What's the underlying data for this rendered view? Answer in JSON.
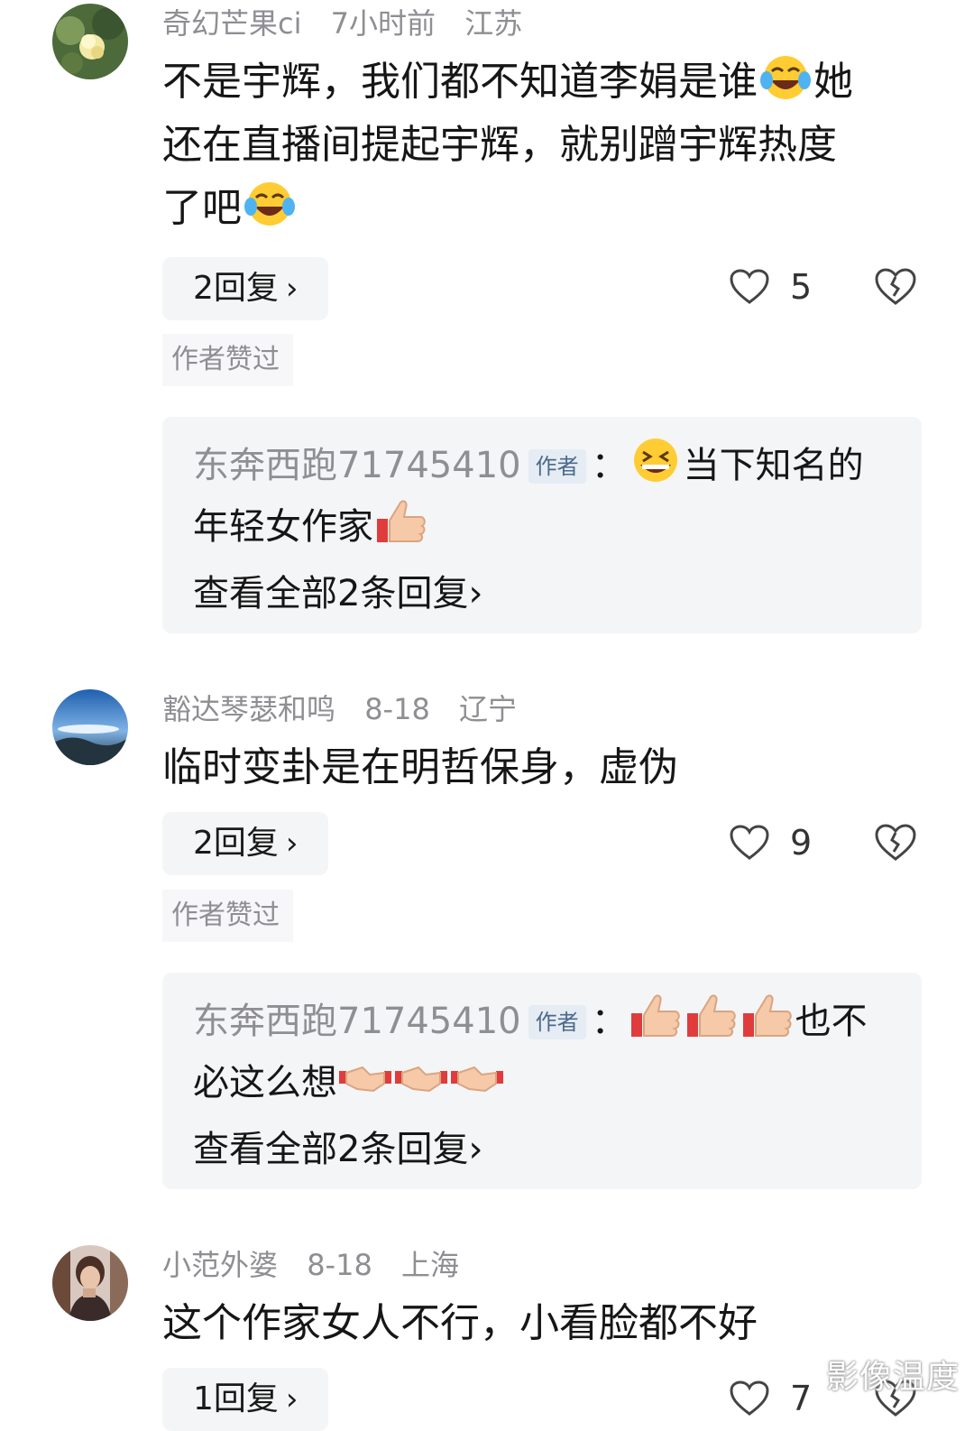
{
  "comments": [
    {
      "username": "奇幻芒果ci",
      "time": "7小时前",
      "location": "江苏",
      "text_line1": "不是宇辉，我们都不知道李娟是谁",
      "text_line1_after": "她",
      "text_line2": "还在直播间提起宇辉，就别蹭宇辉热度",
      "text_line3": "了吧",
      "reply_count_label": "2回复",
      "likes": "5",
      "author_liked": "作者赞过",
      "author_reply": {
        "user": "东奔西跑71745410",
        "badge": "作者",
        "colon": "：",
        "line1": "当下知名的",
        "line2": "年轻女作家",
        "view_all": "查看全部2条回复"
      }
    },
    {
      "username": "豁达琴瑟和鸣",
      "time": "8-18",
      "location": "辽宁",
      "text_line1": "临时变卦是在明哲保身，虚伪",
      "reply_count_label": "2回复",
      "likes": "9",
      "author_liked": "作者赞过",
      "author_reply": {
        "user": "东奔西跑71745410",
        "badge": "作者",
        "colon": "：",
        "line1": "也不",
        "line2": "必这么想",
        "view_all": "查看全部2条回复"
      }
    },
    {
      "username": "小范外婆",
      "time": "8-18",
      "location": "上海",
      "text_line1": "这个作家女人不行，小看脸都不好",
      "reply_count_label": "1回复",
      "likes": "7"
    }
  ],
  "icons": {
    "like": "heart-outline-icon",
    "dislike": "broken-heart-icon",
    "chevron": "chevron-right-icon",
    "emoji_laugh_cry": "laughing-crying-emoji",
    "emoji_grin": "grinning-emoji",
    "emoji_thumbs": "thumbs-up-emoji",
    "emoji_handshake": "handshake-emoji"
  },
  "chevron": "›",
  "watermark": "影像温度",
  "colors": {
    "meta_gray": "#8e8e93",
    "chip_bg": "#f4f5f7",
    "badge_blue": "#4a6a8c"
  }
}
